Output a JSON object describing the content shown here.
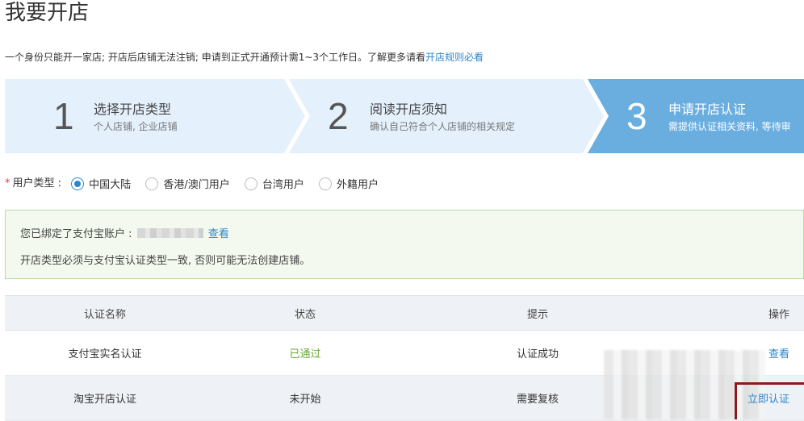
{
  "page": {
    "title": "我要开店",
    "notice_text": "一个身份只能开一家店; 开店后店铺无法注销; 申请到正式开通预计需1~3个工作日。了解更多请看",
    "notice_link": "开店规则必看"
  },
  "steps": [
    {
      "number": "1",
      "title": "选择开店类型",
      "desc": "个人店铺, 企业店铺",
      "active": false
    },
    {
      "number": "2",
      "title": "阅读开店须知",
      "desc": "确认自己符合个人店铺的相关规定",
      "active": false
    },
    {
      "number": "3",
      "title": "申请开店认证",
      "desc": "需提供认证相关资料, 等待审",
      "active": true
    }
  ],
  "user_type": {
    "required_mark": "*",
    "label": "用户类型 :",
    "options": [
      "中国大陆",
      "香港/澳门用户",
      "台湾用户",
      "外籍用户"
    ],
    "selected": "中国大陆"
  },
  "alert": {
    "line1_prefix": "您已绑定了支付宝账户 :",
    "line1_link": "查看",
    "line2": "开店类型必须与支付宝认证类型一致, 否则可能无法创建店铺。"
  },
  "table": {
    "headers": [
      "认证名称",
      "状态",
      "提示",
      "操作"
    ],
    "rows": [
      {
        "name": "支付宝实名认证",
        "status": "已通过",
        "hint": "认证成功",
        "action": "查看"
      },
      {
        "name": "淘宝开店认证",
        "status": "未开始",
        "hint": "需要复核",
        "action": "立即认证"
      }
    ]
  },
  "colors": {
    "step_inactive": "#e4f0fb",
    "step_active": "#6aaee0",
    "link": "#2d86cc",
    "success": "#6aaa3c",
    "alert_bg": "#f3f9ee",
    "alert_border": "#b7db9f"
  }
}
